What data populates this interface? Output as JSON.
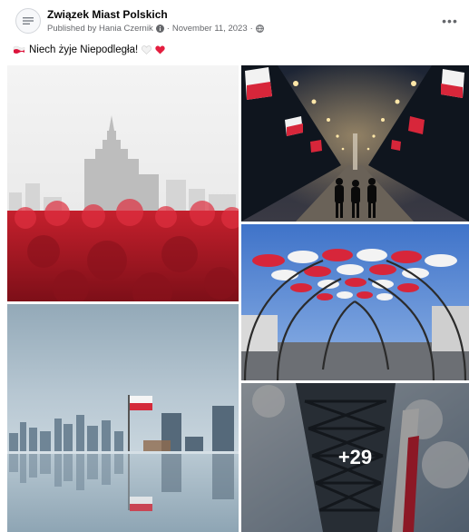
{
  "post": {
    "page_name": "Związek Miast Polskich",
    "published_by": "Published by Hania Czernik",
    "separator": "·",
    "date": "November 11, 2023",
    "caption": "Niech żyje Niepodległa!",
    "more_photos": "+29"
  },
  "icons": {
    "avatar": "city-logo-icon",
    "publisher_info": "info-icon",
    "audience": "globe-icon",
    "menu": "more-options-icon",
    "flag": "poland-flag-emoji",
    "heart": "red-heart-emoji"
  },
  "colors": {
    "text_primary": "#050505",
    "text_secondary": "#65676b",
    "flag_red": "#dc143c",
    "flag_white": "#ffffff"
  }
}
